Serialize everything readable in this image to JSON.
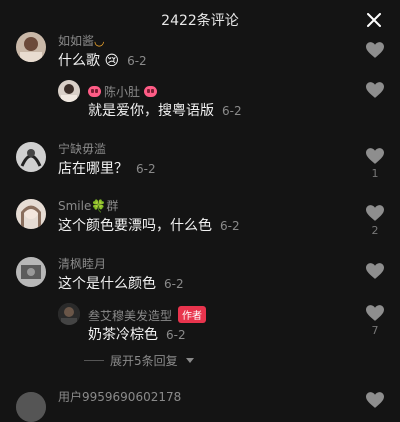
{
  "header": {
    "title": "2422条评论"
  },
  "comments": [
    {
      "name": "如如酱",
      "text": "什么歌",
      "emoji": "😢",
      "date": "6-2"
    },
    {
      "name": "陈小肚",
      "text": "就是爱你，搜粤语版",
      "date": "6-2"
    },
    {
      "name": "宁缺毋滥",
      "text": "店在哪里？",
      "date": "6-2",
      "likes": "1"
    },
    {
      "name": "Smile",
      "name_suffix": "群",
      "name_icon": "🍀",
      "text": "这个颜色要漂吗，什么色",
      "date": "6-2",
      "likes": "2"
    },
    {
      "name": "清枫睦月",
      "text": "这个是什么颜色",
      "date": "6-2"
    },
    {
      "name": "叁艾穆美发造型",
      "badge": "作者",
      "text": "奶茶冷棕色",
      "date": "6-2",
      "likes": "7"
    },
    {
      "name": "用户9959690602178"
    }
  ],
  "expand_replies": "展开5条回复",
  "colors": {
    "background": "#141414",
    "badge": "#e8344d",
    "muted": "#8a8a8a"
  }
}
